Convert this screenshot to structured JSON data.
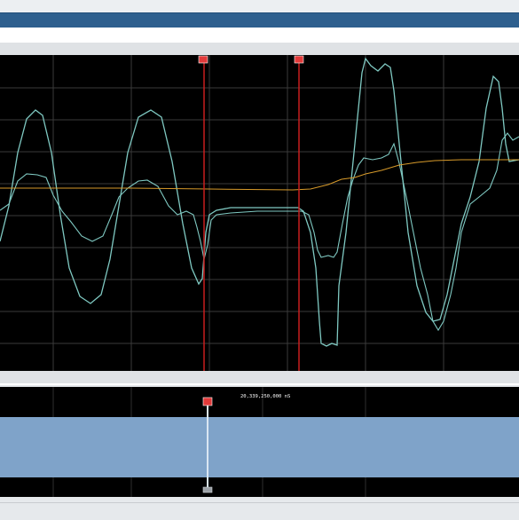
{
  "overview": {
    "timestamp_label": "20,339,250,000 nS"
  },
  "colors": {
    "background": "#000000",
    "grid": "#3a3a3a",
    "trace_primary": "#7fc9c2",
    "trace_secondary": "#7fc9c2",
    "trace_tertiary": "#d79a2a",
    "cursor": "#c81e1e",
    "overview_fill": "#7fa3c9"
  },
  "icons": {
    "cursor_marker": "cursor-flag-icon",
    "scrubber_handle": "scrubber-handle-icon"
  }
}
